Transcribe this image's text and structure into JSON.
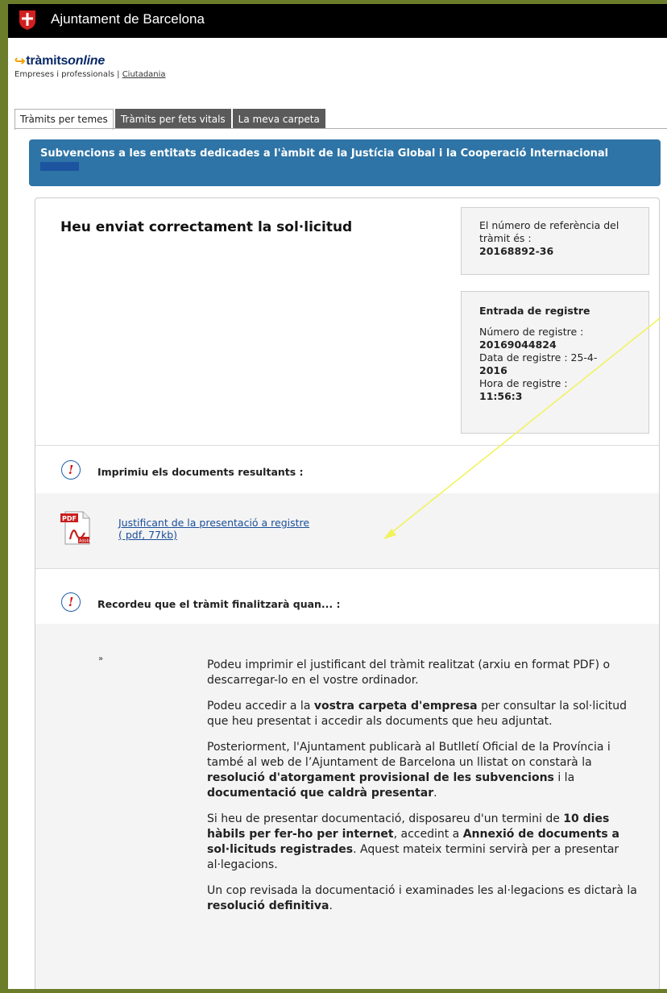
{
  "header": {
    "site_name": "Ajuntament de Barcelona"
  },
  "brand": {
    "logo_part1": "tràmits",
    "logo_part2": "online",
    "sub_prefix": "Empreses i professionals | ",
    "sub_link": "Ciutadania"
  },
  "tabs": [
    {
      "label": "Tràmits per temes"
    },
    {
      "label": "Tràmits per fets vitals"
    },
    {
      "label": "La meva carpeta"
    }
  ],
  "title": {
    "text": "Subvencions a les entitats dedicades a l'àmbit de la Justícia Global i la Cooperació Internacional"
  },
  "confirmation": {
    "heading": "Heu enviat correctament la sol·licitud"
  },
  "reference": {
    "label": "El número de referència del tràmit és :",
    "value": "20168892-36"
  },
  "registry": {
    "heading": "Entrada de registre",
    "number_label": "Número de registre :",
    "number_value": "20169044824",
    "date_label": "Data de registre : 25-4-",
    "date_value": "2016",
    "time_label": "Hora de registre :",
    "time_value": "11:56:3"
  },
  "print_section": {
    "label": "Imprimiu els documents resultants :",
    "doc_title": "Justificant de la presentació a registre",
    "doc_meta": "( pdf, 77kb)"
  },
  "reminder": {
    "label": "Recordeu que el tràmit finalitzarà quan... :",
    "bullet": "»",
    "p1": "Podeu imprimir el justificant del tràmit realitzat (arxiu en format PDF) o descarregar-lo en el vostre ordinador.",
    "p2_a": "Podeu accedir a la ",
    "p2_b": "vostra carpeta d'empresa",
    "p2_c": " per consultar la sol·licitud que heu presentat i accedir als documents que heu adjuntat.",
    "p3_a": "Posteriorment, l'Ajuntament publicarà al Butlletí Oficial de la Província i també al web de l’Ajuntament de Barcelona un llistat on constarà la ",
    "p3_b": "resolució d'atorgament provisional de les subvencions",
    "p3_c": " i la ",
    "p3_d": "documentació que caldrà presentar",
    "p3_e": ".",
    "p4_a": "Si heu de presentar documentació, disposareu d'un termini de ",
    "p4_b": "10 dies hàbils per fer-ho per internet",
    "p4_c": ", accedint a ",
    "p4_d": "Annexió de documents a sol·licituds registrades",
    "p4_e": ". Aquest mateix termini servirà per a presentar al·legacions.",
    "p5_a": "Un cop revisada la documentació i examinades les al·legacions es dictarà la ",
    "p5_b": "resolució definitiva",
    "p5_c": "."
  },
  "colors": {
    "title_bar": "#2e74a6",
    "frame": "#6b7d2a",
    "annotation_arrow": "#f2f25a"
  }
}
